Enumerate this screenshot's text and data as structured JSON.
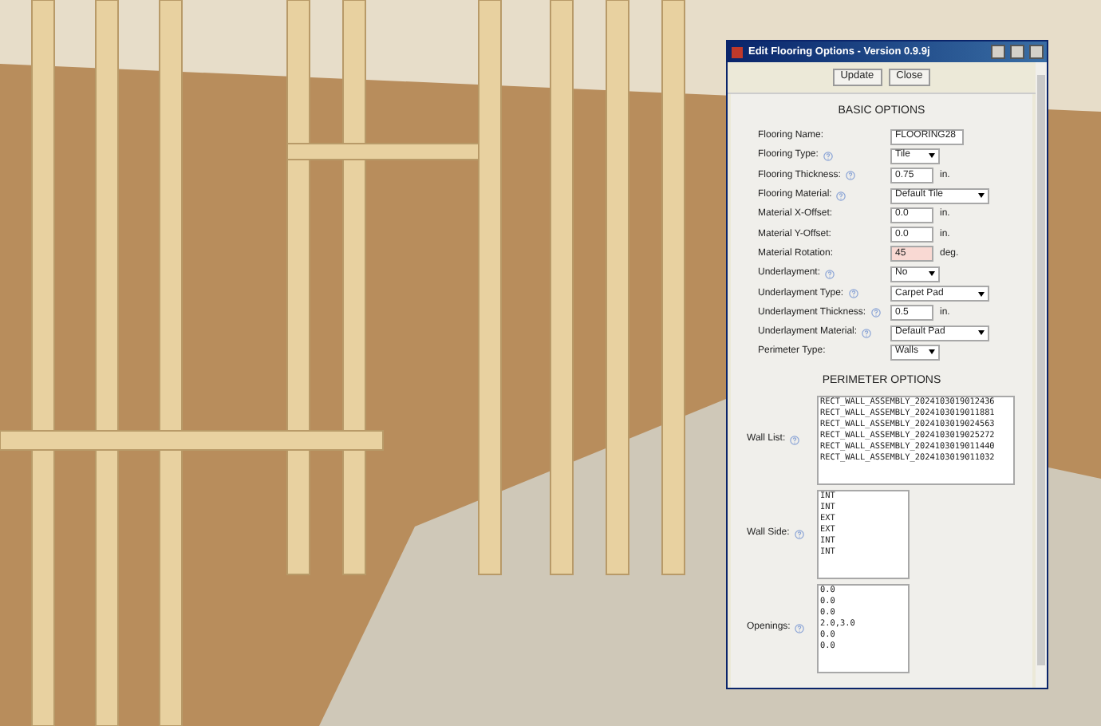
{
  "window": {
    "title": "Edit Flooring Options - Version 0.9.9j"
  },
  "buttons": [
    "Update",
    "Close"
  ],
  "basic_options": {
    "heading": "BASIC OPTIONS",
    "fields": [
      {
        "label": "Flooring Name:",
        "kind": "text",
        "value": "FLOORING28",
        "help": false,
        "highlighted": false
      },
      {
        "label": "Flooring Type:",
        "kind": "select",
        "value": "Tile",
        "help": true
      },
      {
        "label": "Flooring Thickness:",
        "kind": "text",
        "value": "0.75",
        "unit": "in.",
        "help": true,
        "highlighted": false
      },
      {
        "label": "Flooring Material:",
        "kind": "select",
        "value": "Default Tile",
        "help": true
      },
      {
        "label": "Material X-Offset:",
        "kind": "text",
        "value": "0.0",
        "unit": "in.",
        "help": false,
        "highlighted": false
      },
      {
        "label": "Material Y-Offset:",
        "kind": "text",
        "value": "0.0",
        "unit": "in.",
        "help": false,
        "highlighted": false
      },
      {
        "label": "Material Rotation:",
        "kind": "text",
        "value": "45",
        "unit": "deg.",
        "help": false,
        "highlighted": true
      },
      {
        "label": "Underlayment:",
        "kind": "select",
        "value": "No",
        "help": true
      },
      {
        "label": "Underlayment Type:",
        "kind": "select",
        "value": "Carpet Pad",
        "help": true
      },
      {
        "label": "Underlayment Thickness:",
        "kind": "text",
        "value": "0.5",
        "unit": "in.",
        "help": true,
        "highlighted": false
      },
      {
        "label": "Underlayment Material:",
        "kind": "select",
        "value": "Default Pad",
        "help": true
      },
      {
        "label": "Perimeter Type:",
        "kind": "select",
        "value": "Walls",
        "help": false
      }
    ]
  },
  "perimeter_options": {
    "heading": "PERIMETER OPTIONS",
    "fields": [
      {
        "label": "Wall List:",
        "help": true,
        "wide": true,
        "lines": [
          "RECT_WALL_ASSEMBLY_2024103019012436",
          "RECT_WALL_ASSEMBLY_2024103019011881",
          "RECT_WALL_ASSEMBLY_2024103019024563",
          "RECT_WALL_ASSEMBLY_2024103019025272",
          "RECT_WALL_ASSEMBLY_2024103019011440",
          "RECT_WALL_ASSEMBLY_2024103019011032"
        ]
      },
      {
        "label": "Wall Side:",
        "help": true,
        "wide": false,
        "lines": [
          "INT",
          "INT",
          "EXT",
          "EXT",
          "INT",
          "INT"
        ]
      },
      {
        "label": "Openings:",
        "help": true,
        "wide": false,
        "lines": [
          "0.0",
          "0.0",
          "0.0",
          "2.0,3.0",
          "0.0",
          "0.0"
        ]
      }
    ]
  }
}
